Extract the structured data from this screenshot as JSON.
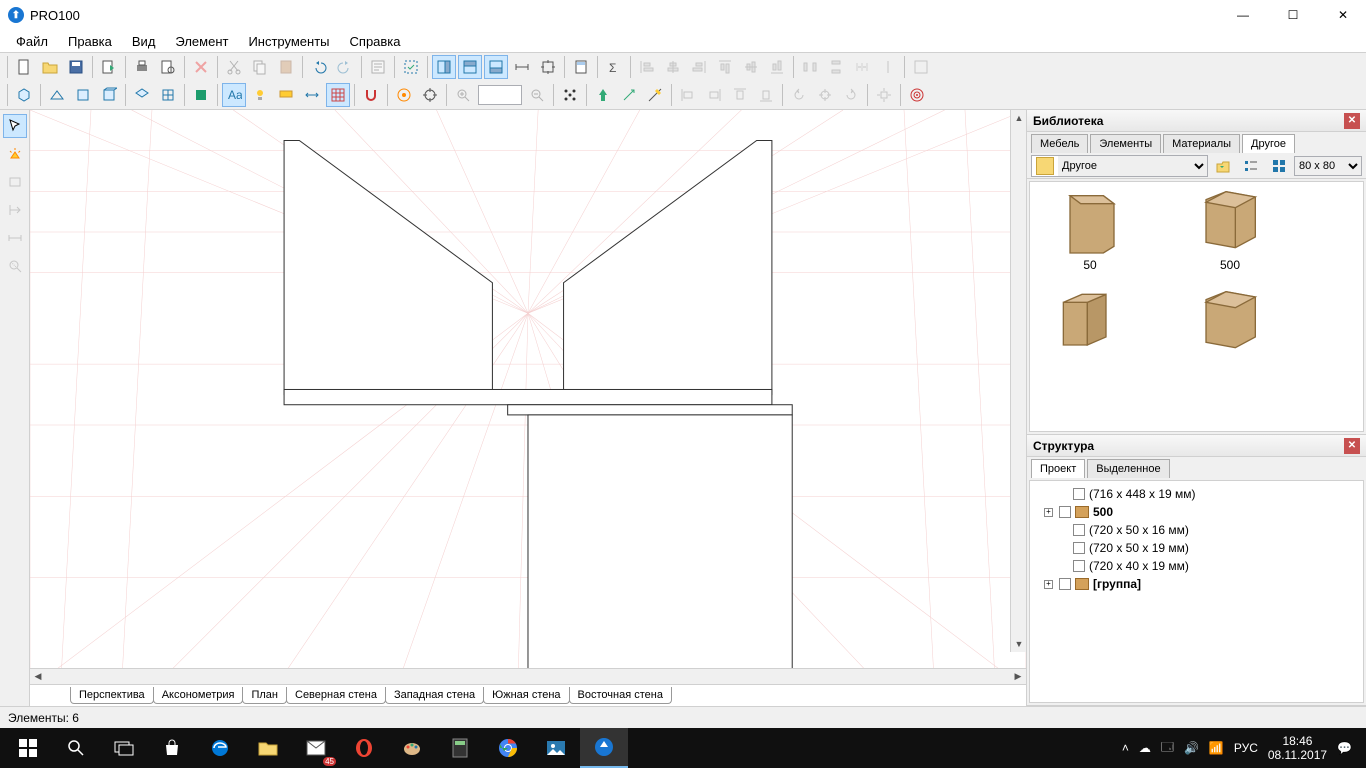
{
  "app": {
    "title": "PRO100"
  },
  "window_controls": {
    "min": "—",
    "max": "☐",
    "close": "✕"
  },
  "menu": [
    "Файл",
    "Правка",
    "Вид",
    "Элемент",
    "Инструменты",
    "Справка"
  ],
  "viewtabs": [
    "Перспектива",
    "Аксонометрия",
    "План",
    "Северная стена",
    "Западная стена",
    "Южная стена",
    "Восточная стена"
  ],
  "viewtabs_active": 0,
  "library": {
    "title": "Библиотека",
    "tabs": [
      "Мебель",
      "Элементы",
      "Материалы",
      "Другое"
    ],
    "active_tab": 3,
    "folder": "Другое",
    "thumbsize": "80 x  80",
    "items": [
      {
        "label": "50"
      },
      {
        "label": "500"
      },
      {
        "label": ""
      },
      {
        "label": ""
      }
    ]
  },
  "structure": {
    "title": "Структура",
    "tabs": [
      "Проект",
      "Выделенное"
    ],
    "active_tab": 0,
    "rows": [
      {
        "indent": 1,
        "exp": "",
        "label": "(716 x 448 x 19 мм)",
        "bold": false,
        "ico": false
      },
      {
        "indent": 0,
        "exp": "+",
        "label": "500",
        "bold": true,
        "ico": true
      },
      {
        "indent": 1,
        "exp": "",
        "label": "(720 x 50 x 16 мм)",
        "bold": false,
        "ico": false
      },
      {
        "indent": 1,
        "exp": "",
        "label": "(720 x 50 x 19 мм)",
        "bold": false,
        "ico": false
      },
      {
        "indent": 1,
        "exp": "",
        "label": "(720 x 40 x 19 мм)",
        "bold": false,
        "ico": false
      },
      {
        "indent": 0,
        "exp": "+",
        "label": "[группа]",
        "bold": true,
        "ico": true
      }
    ]
  },
  "status": {
    "text": "Элементы: 6"
  },
  "taskbar": {
    "time": "18:46",
    "date": "08.11.2017",
    "lang": "РУС",
    "badge": "45"
  }
}
